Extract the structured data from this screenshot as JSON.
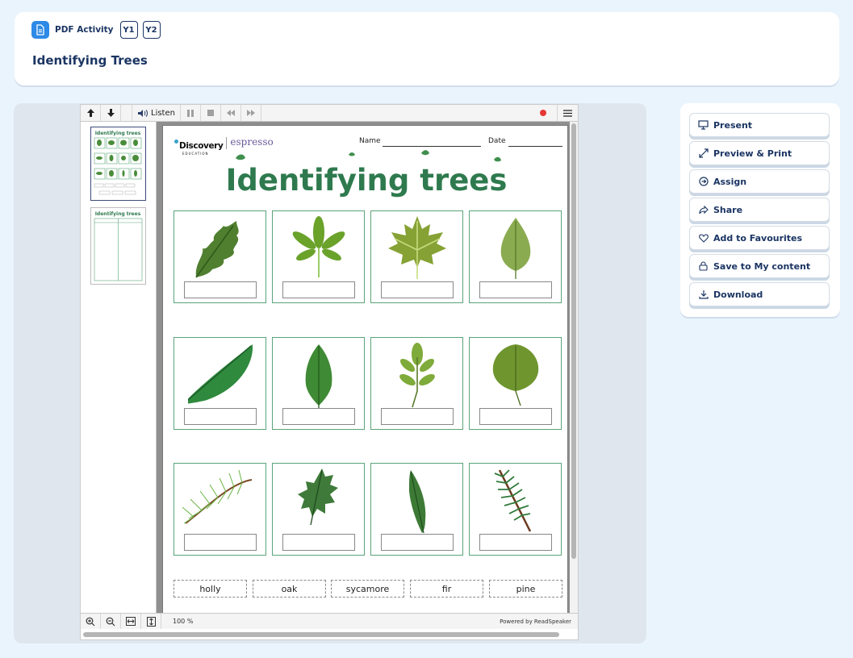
{
  "header": {
    "type_label": "PDF Activity",
    "years": [
      "Y1",
      "Y2"
    ],
    "title": "Identifying Trees"
  },
  "viewer": {
    "toolbar": {
      "listen_label": "Listen"
    },
    "zoom_level": "100 %",
    "powered_by": "Powered by ReadSpeaker",
    "thumbnails_count": 2
  },
  "worksheet": {
    "logo_main": "Discovery",
    "logo_sub": "EDUCATION",
    "logo_brand": "espresso",
    "name_label": "Name",
    "date_label": "Date",
    "title": "Identifying trees",
    "leaves": [
      "oak-leaf",
      "horse-chestnut-leaf",
      "maple-leaf",
      "birch-leaf",
      "banana-leaf",
      "beech-leaf",
      "ash-leaf",
      "hazel-leaf",
      "pine-needles",
      "holly-leaf",
      "willow-leaf",
      "fir-sprig"
    ],
    "word_bank": [
      "holly",
      "oak",
      "sycamore",
      "fir",
      "pine"
    ]
  },
  "actions": [
    {
      "label": "Present",
      "icon": "present-icon"
    },
    {
      "label": "Preview & Print",
      "icon": "expand-icon"
    },
    {
      "label": "Assign",
      "icon": "assign-icon"
    },
    {
      "label": "Share",
      "icon": "share-icon"
    },
    {
      "label": "Add to Favourites",
      "icon": "heart-icon"
    },
    {
      "label": "Save to My content",
      "icon": "lock-icon"
    },
    {
      "label": "Download",
      "icon": "download-icon"
    }
  ],
  "colors": {
    "background": "#eaf4fd",
    "navy": "#1b3563",
    "accent_blue": "#2d8ae6",
    "leaf_green": "#2e7a4e"
  }
}
